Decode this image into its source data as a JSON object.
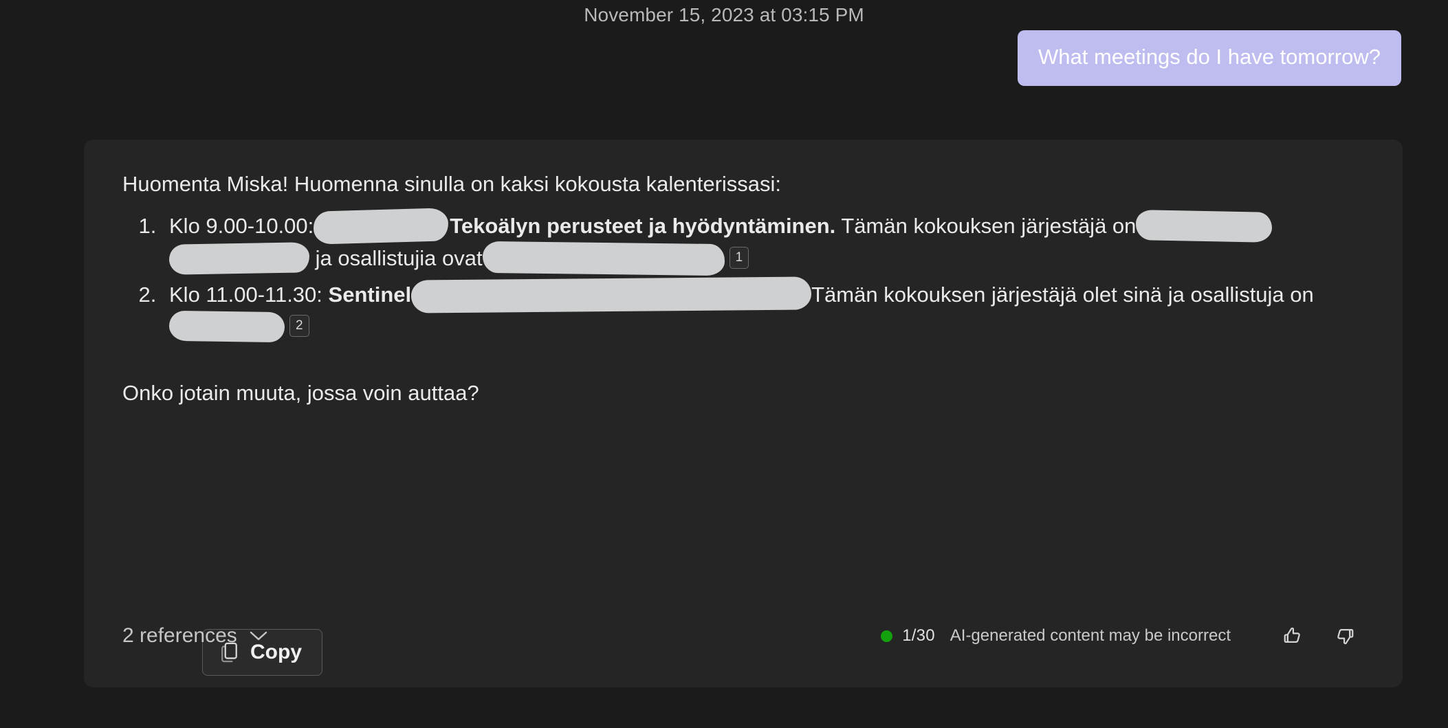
{
  "conversation": {
    "timestamp": "November 15, 2023 at 03:15 PM",
    "user_message": {
      "text": "What meetings do I have tomorrow?",
      "bubble_color": "#bfbdf0"
    },
    "assistant_message": {
      "greeting": "Huomenta Miska! Huomenna sinulla on kaksi kokousta kalenterissasi:",
      "list": [
        {
          "marker": "1.",
          "time_label": "Klo 9.00-10.00:",
          "title": "Tekoälyn perusteet ja hyödyntäminen.",
          "organizer_text": "Tämän kokouksen järjestäjä on",
          "participants_text": "ja osallistujia ovat",
          "citation": "1"
        },
        {
          "marker": "2.",
          "time_label": "Klo 11.00-11.30:",
          "title": "Sentinel",
          "organizer_text": "Tämän kokouksen järjestäjä olet sinä ja",
          "participants_text": "osallistuja on",
          "citation": "2"
        }
      ],
      "closing": "Onko jotain muuta, jossa voin auttaa?"
    },
    "copy_button": {
      "label": "Copy",
      "icon": "copy-icon"
    },
    "footer": {
      "references_label": "2 references",
      "chevron_icon": "chevron-down-icon",
      "status_dot_color": "#13a10e",
      "counter": "1/30",
      "disclaimer": "AI-generated content may be incorrect",
      "thumbs_up_icon": "thumbs-up-icon",
      "thumbs_down_icon": "thumbs-down-icon"
    }
  }
}
